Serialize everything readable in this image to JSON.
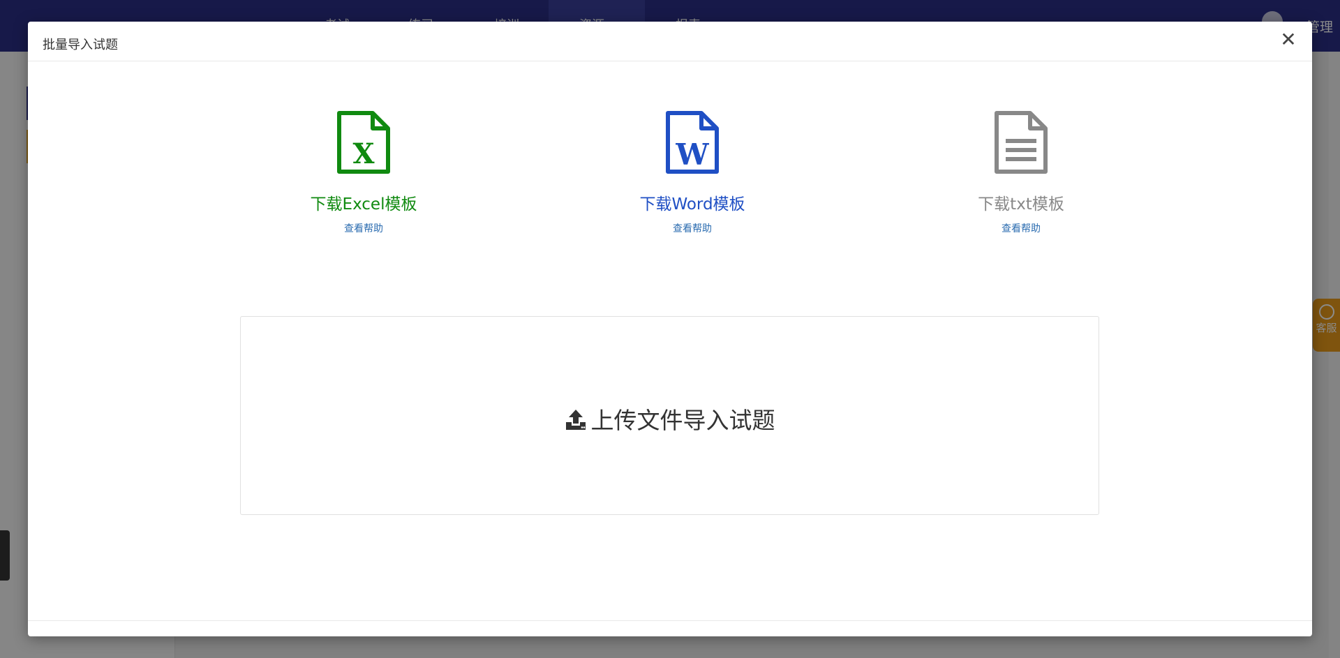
{
  "background": {
    "nav_items": [
      "考试",
      "练习",
      "培训",
      "资源",
      "报表"
    ],
    "manage_label": "管理",
    "service_label": "客服"
  },
  "modal": {
    "title": "批量导入试题",
    "close_glyph": "✕",
    "templates": [
      {
        "label": "下载Excel模板",
        "help": "查看帮助",
        "color": "#108a10",
        "icon": "excel-file-icon",
        "glyph": "X"
      },
      {
        "label": "下载Word模板",
        "help": "查看帮助",
        "color": "#1f4fc4",
        "icon": "word-file-icon",
        "glyph": "W"
      },
      {
        "label": "下载txt模板",
        "help": "查看帮助",
        "color": "#888888",
        "icon": "txt-file-icon"
      }
    ],
    "upload_label": "上传文件导入试题"
  }
}
